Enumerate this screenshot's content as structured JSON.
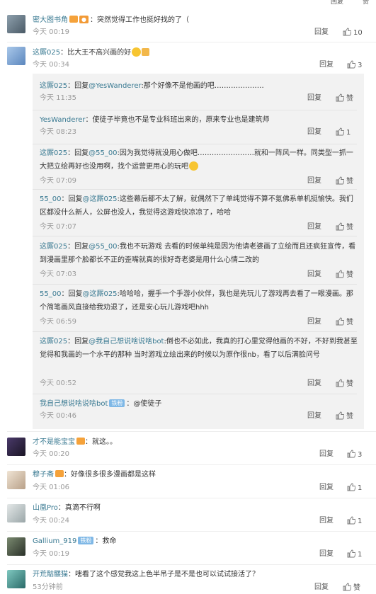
{
  "main": [
    {
      "user": "密大图书角",
      "sep": "：",
      "text": "突然觉得工作也挺好找的了（",
      "time": "今天 00:19",
      "reply": "回复",
      "likes": "10",
      "av": "#5b6b78",
      "badges": [
        "vip",
        "orange"
      ]
    },
    {
      "user": "这厮025",
      "sep": "：",
      "text": "比大王不高兴画的好",
      "time": "今天 00:34",
      "reply": "回复",
      "likes": "3",
      "av": "#6b98c8",
      "badges": [],
      "emojis": true
    },
    {
      "user": "才不是能宝宝",
      "sep": "：",
      "text": "就这。。",
      "time": "今天 00:20",
      "reply": "回复",
      "likes": "3",
      "av": "#2b2240",
      "badges": [
        "vip"
      ]
    },
    {
      "user": "穆子斋",
      "sep": "：",
      "text": "好像很多很多漫画都是这样",
      "time": "今天 01:06",
      "reply": "回复",
      "likes": "1",
      "av": "#d8c8b8",
      "badges": [
        "vip"
      ]
    },
    {
      "user": "山凰Pro",
      "sep": "：",
      "text": "真滴不行啊",
      "time": "今天 00:24",
      "reply": "回复",
      "likes": "1",
      "av": "#c8cfd0",
      "badges": []
    },
    {
      "user": "Gallium_919",
      "sep": "：",
      "text": "救命",
      "time": "今天 00:19",
      "reply": "回复",
      "likes": "1",
      "av": "#3b4a40",
      "badges": [
        "blue"
      ]
    },
    {
      "user": "开荒骷髅猫",
      "sep": "：",
      "text": "嗐看了这个感觉我这上色半吊子是不是也可以试试接活了？",
      "time": "53分钟前",
      "reply": "回复",
      "likes": "赞",
      "av": "#4a8a86",
      "badges": []
    }
  ],
  "badge_fan": "铁粉",
  "replies": [
    {
      "user": "这厮025",
      "pre": "：回复",
      "mention": "@YesWanderer",
      "rest": ":那个好像不是他画的吧…………………",
      "time": "今天 11:35",
      "reply": "回复",
      "likes": "赞"
    },
    {
      "user": "YesWanderer",
      "pre": "：使徒子毕竟也不是专业科班出来的，原来专业也是建筑师",
      "mention": "",
      "rest": "",
      "time": "今天 08:23",
      "reply": "回复",
      "likes": "1"
    },
    {
      "user": "这厮025",
      "pre": "：回复",
      "mention": "@55_00",
      "rest": ":因为我觉得就没用心做吧……………………就和一阵风一样。同类型一抓一大把立绘再好也没用啊，找个运营更用心的玩吧",
      "time": "今天 07:09",
      "reply": "回复",
      "likes": "赞"
    },
    {
      "user": "55_00",
      "pre": "：回复",
      "mention": "@这厮025",
      "rest": ":这些幕后都不太了解，就偶然下了单纯觉得不算不氪佛系单机挺愉快。我们区都没什么新人，公屏也没人，我觉得这游戏快凉凉了，哈哈",
      "time": "今天 07:07",
      "reply": "回复",
      "likes": "赞"
    },
    {
      "user": "这厮025",
      "pre": "：回复",
      "mention": "@55_00",
      "rest": ":我也不玩游戏 去看的时候单纯是因为他请老婆画了立绘而且还疯狂宣传，看到漫画里那个脸都长不正的歪嘴就真的很好奇老婆是用什么心情二改的",
      "time": "今天 07:03",
      "reply": "回复",
      "likes": "赞"
    },
    {
      "user": "55_00",
      "pre": "：回复",
      "mention": "@这厮025",
      "rest": ":哈哈哈，握手一个手游小伙伴，我也是先玩儿了游戏再去看了一眼漫画。那个简笔画风直接给我劝退了，还是安心玩儿游戏吧hhh",
      "time": "今天 06:59",
      "reply": "回复",
      "likes": "赞"
    },
    {
      "user": "这厮025",
      "pre": "：回复",
      "mention": "@我自己想说啥说啥bot",
      "rest": ":倒也不必如此，我真的打心里觉得他画的不好，不好到我甚至觉得和我画的一个水平的那种 当时游戏立绘出来的时候以为原作很nb，看了以后满脸问号",
      "time": "今天 00:52",
      "reply": "回复",
      "likes": "赞"
    },
    {
      "user": "我自己想说啥说啥bot",
      "pre": "：@使徒子",
      "mention": "",
      "rest": "",
      "time": "今天 00:46",
      "reply": "回复",
      "likes": "赞",
      "fan": true
    }
  ]
}
